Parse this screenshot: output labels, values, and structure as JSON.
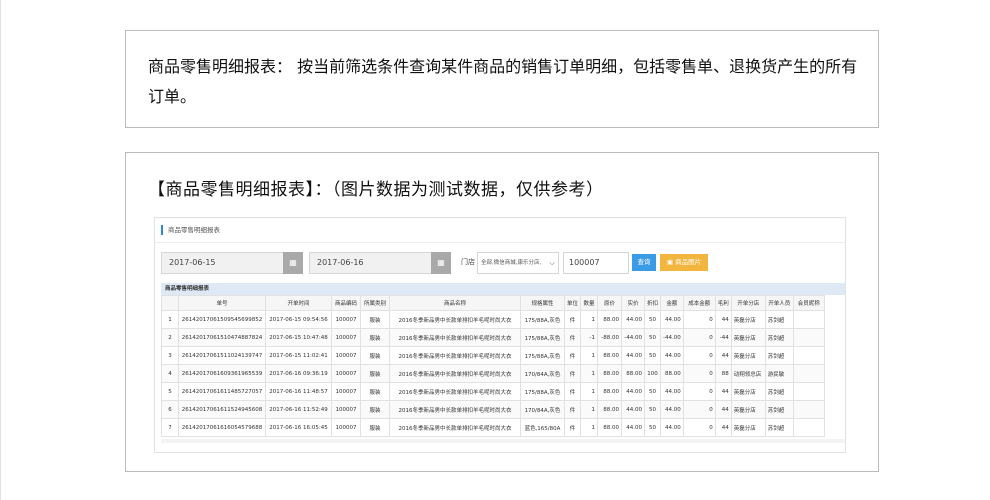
{
  "intro": {
    "text": "商品零售明细报表： 按当前筛选条件查询某件商品的销售订单明细，包括零售单、退换货产生的所有订单。"
  },
  "screenshot_section": {
    "heading": "【商品零售明细报表】：（图片数据为测试数据，仅供参考）"
  },
  "app": {
    "title": "商品零售明细报表",
    "filters": {
      "start_date": "2017-06-15",
      "end_date": "2017-06-16",
      "calendar_icon": "calendar-icon",
      "store_label": "门店",
      "store_value": "全部,微信商城,康乐分店,",
      "product_code": "100007",
      "query_label": "查询",
      "image_label": "商品图片",
      "image_icon": "image-icon"
    },
    "section_title": "商品零售明细报表",
    "columns": [
      "",
      "单号",
      "开单时间",
      "商品编码",
      "所属类别",
      "商品名称",
      "规格属性",
      "单位",
      "数量",
      "原价",
      "实价",
      "折扣",
      "金额",
      "成本金额",
      "毛利",
      "开单分店",
      "开单人员",
      "会员昵称"
    ],
    "rows": [
      [
        "1",
        "26142017061509545699852",
        "2017-06-15 09:54:56",
        "100007",
        "服装",
        "2016冬季新品男中长款单排扣羊毛呢时尚大衣",
        "175/88A,灰色",
        "件",
        "1",
        "88.00",
        "44.00",
        "50",
        "44.00",
        "0",
        "44",
        "英磊分店",
        "苏剑超",
        ""
      ],
      [
        "2",
        "26142017061510474887824",
        "2017-06-15 10:47:48",
        "100007",
        "服装",
        "2016冬季新品男中长款单排扣羊毛呢时尚大衣",
        "175/88A,灰色",
        "件",
        "-1",
        "-88.00",
        "-44.00",
        "50",
        "-44.00",
        "0",
        "-44",
        "英磊分店",
        "苏剑超",
        ""
      ],
      [
        "3",
        "26142017061511024139747",
        "2017-06-15 11:02:41",
        "100007",
        "服装",
        "2016冬季新品男中长款单排扣羊毛呢时尚大衣",
        "175/88A,灰色",
        "件",
        "1",
        "88.00",
        "44.00",
        "50",
        "44.00",
        "0",
        "44",
        "英磊分店",
        "苏剑超",
        ""
      ],
      [
        "4",
        "26142017061609361965539",
        "2017-06-16 09:36:19",
        "100007",
        "服装",
        "2016冬季新品男中长款单排扣羊毛呢时尚大衣",
        "170/84A,灰色",
        "件",
        "1",
        "88.00",
        "88.00",
        "100",
        "88.00",
        "0",
        "88",
        "动翔领总店",
        "游民敏",
        ""
      ],
      [
        "5",
        "26142017061611485727057",
        "2017-06-16 11:48:57",
        "100007",
        "服装",
        "2016冬季新品男中长款单排扣羊毛呢时尚大衣",
        "175/88A,灰色",
        "件",
        "1",
        "88.00",
        "44.00",
        "50",
        "44.00",
        "0",
        "44",
        "英磊分店",
        "苏剑超",
        ""
      ],
      [
        "6",
        "26142017061611524945608",
        "2017-06-16 11:52:49",
        "100007",
        "服装",
        "2016冬季新品男中长款单排扣羊毛呢时尚大衣",
        "170/84A,灰色",
        "件",
        "1",
        "88.00",
        "44.00",
        "50",
        "44.00",
        "0",
        "44",
        "英磊分店",
        "苏剑超",
        ""
      ],
      [
        "7",
        "26142017061616054579688",
        "2017-06-16 16:05:45",
        "100007",
        "服装",
        "2016冬季新品男中长款单排扣羊毛呢时尚大衣",
        "蓝色,165/80A",
        "件",
        "1",
        "88.00",
        "44.00",
        "50",
        "44.00",
        "0",
        "44",
        "英磊分店",
        "苏剑超",
        ""
      ]
    ]
  }
}
